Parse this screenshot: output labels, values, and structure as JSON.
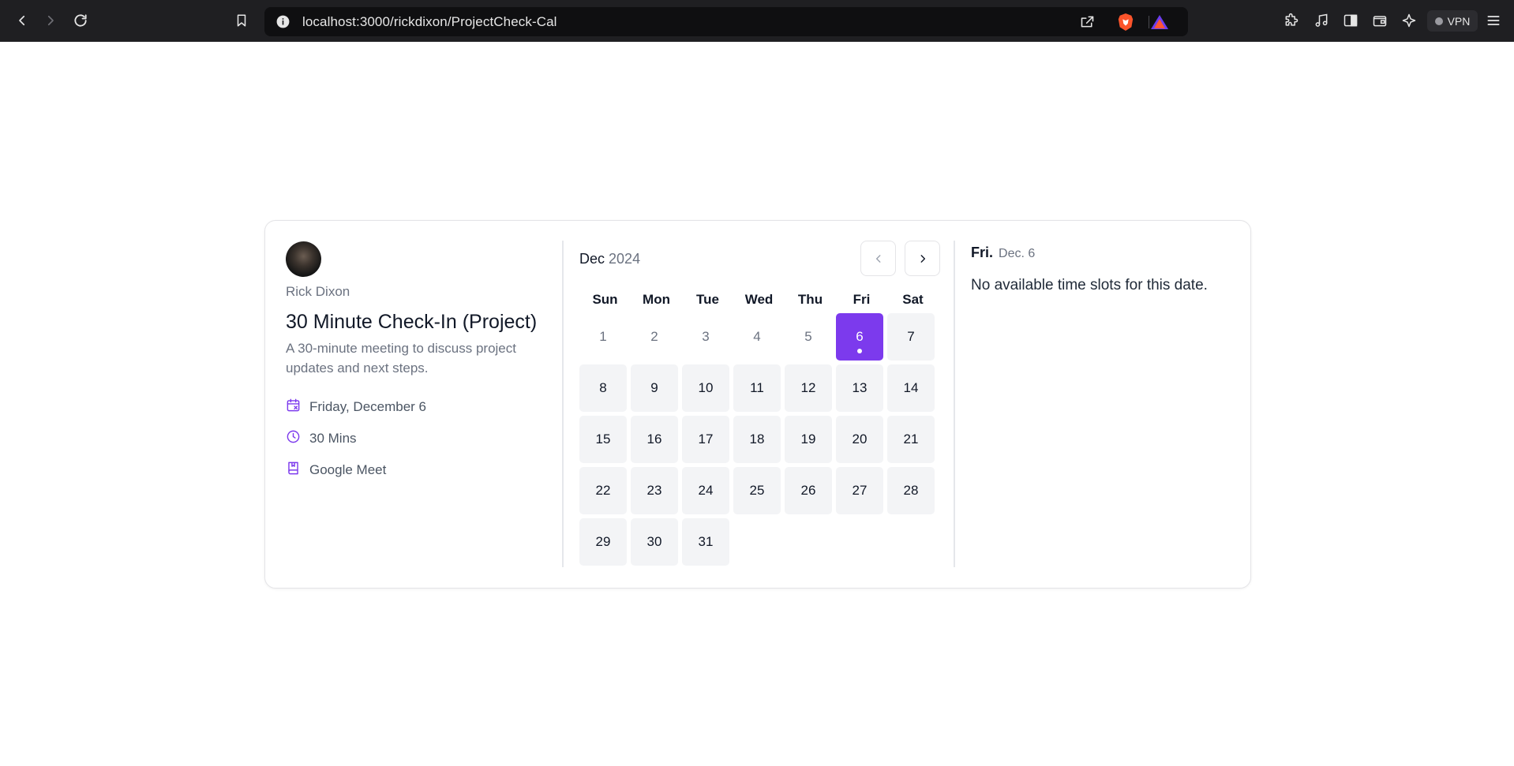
{
  "browser": {
    "url": "localhost:3000/rickdixon/ProjectCheck-Cal",
    "vpn_label": "VPN"
  },
  "host": {
    "name": "Rick Dixon"
  },
  "event": {
    "title": "30 Minute Check-In (Project)",
    "description": "A 30-minute meeting to discuss project updates and next steps.",
    "date": "Friday, December 6",
    "duration": "30 Mins",
    "location": "Google Meet"
  },
  "calendar": {
    "month": "Dec",
    "year": "2024",
    "weekdays": [
      "Sun",
      "Mon",
      "Tue",
      "Wed",
      "Thu",
      "Fri",
      "Sat"
    ],
    "days": [
      "1",
      "2",
      "3",
      "4",
      "5",
      "6",
      "7",
      "8",
      "9",
      "10",
      "11",
      "12",
      "13",
      "14",
      "15",
      "16",
      "17",
      "18",
      "19",
      "20",
      "21",
      "22",
      "23",
      "24",
      "25",
      "26",
      "27",
      "28",
      "29",
      "30",
      "31"
    ],
    "past_days": [
      "1",
      "2",
      "3",
      "4",
      "5"
    ],
    "selected_day": "6"
  },
  "slots": {
    "day_label": "Fri.",
    "date_label": "Dec. 6",
    "empty_message": "No available time slots for this date."
  },
  "colors": {
    "accent": "#7c3aed",
    "chrome": "#1f1f22"
  }
}
